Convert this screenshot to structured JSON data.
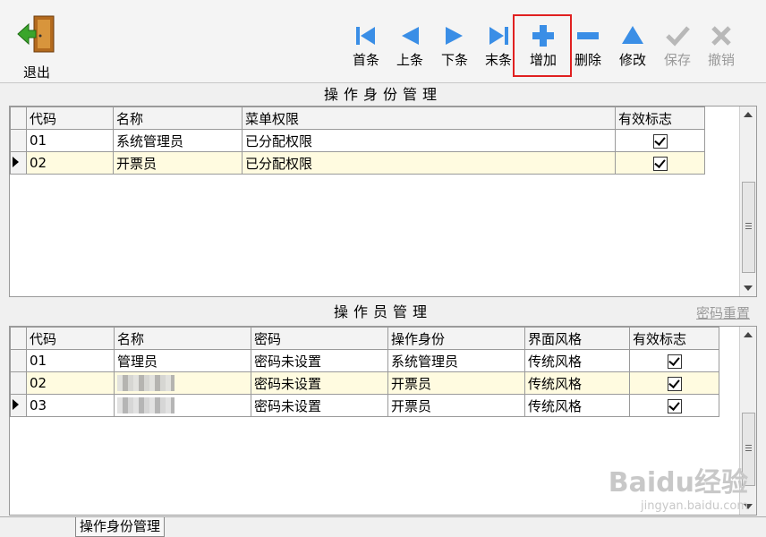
{
  "toolbar": {
    "exit_label": "退出",
    "buttons": [
      {
        "label": "首条",
        "icon": "first-icon"
      },
      {
        "label": "上条",
        "icon": "prev-icon"
      },
      {
        "label": "下条",
        "icon": "next-icon"
      },
      {
        "label": "末条",
        "icon": "last-icon"
      },
      {
        "label": "增加",
        "icon": "add-icon"
      },
      {
        "label": "删除",
        "icon": "delete-icon"
      },
      {
        "label": "修改",
        "icon": "edit-icon"
      },
      {
        "label": "保存",
        "icon": "save-icon"
      },
      {
        "label": "撤销",
        "icon": "cancel-icon"
      }
    ]
  },
  "role_panel": {
    "title": "操作身份管理",
    "headers": [
      "代码",
      "名称",
      "菜单权限",
      "有效标志"
    ],
    "rows": [
      {
        "code": "01",
        "name": "系统管理员",
        "perm": "已分配权限",
        "valid": true
      },
      {
        "code": "02",
        "name": "开票员",
        "perm": "已分配权限",
        "valid": true
      }
    ]
  },
  "operator_panel": {
    "title": "操作员管理",
    "reset_link": "密码重置",
    "headers": [
      "代码",
      "名称",
      "密码",
      "操作身份",
      "界面风格",
      "有效标志"
    ],
    "rows": [
      {
        "code": "01",
        "name": "管理员",
        "pwd": "密码未设置",
        "role": "系统管理员",
        "style": "传统风格",
        "valid": true
      },
      {
        "code": "02",
        "name": "",
        "pwd": "密码未设置",
        "role": "开票员",
        "style": "传统风格",
        "valid": true
      },
      {
        "code": "03",
        "name": "",
        "pwd": "密码未设置",
        "role": "开票员",
        "style": "传统风格",
        "valid": true
      }
    ]
  },
  "tabs": {
    "active": "操作身份管理"
  },
  "watermark": {
    "brand": "Baidu经验",
    "url": "jingyan.baidu.com"
  },
  "colors": {
    "accent_blue": "#3a8ee6",
    "highlight_box": "#e02020",
    "selected_row": "#fffbe0"
  }
}
